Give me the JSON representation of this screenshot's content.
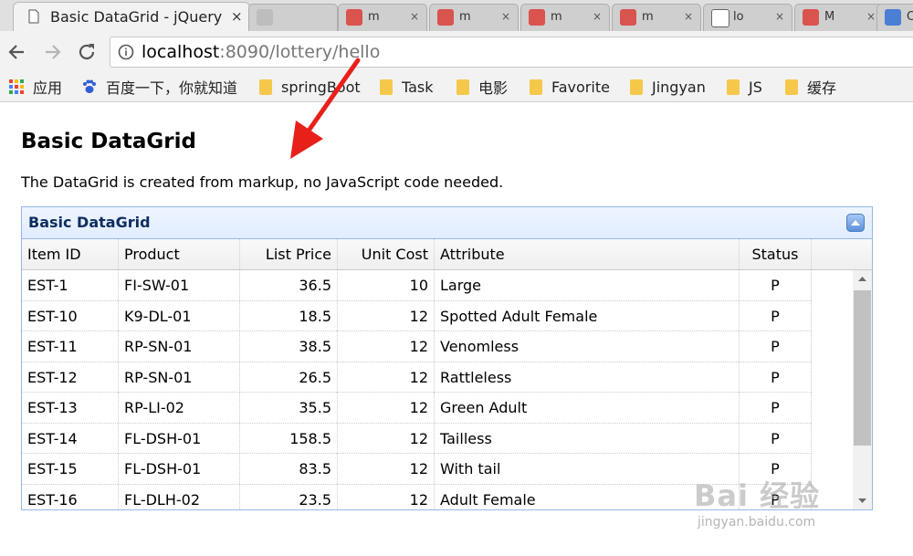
{
  "browser": {
    "active_tab": {
      "title": "Basic DataGrid - jQuery",
      "close": "×"
    },
    "background_tabs": [
      {
        "label": "",
        "close": "",
        "color": "#bdbdbd"
      },
      {
        "label": "m",
        "close": "×",
        "color": "#d9534f"
      },
      {
        "label": "m",
        "close": "×",
        "color": "#d9534f"
      },
      {
        "label": "m",
        "close": "×",
        "color": "#d9534f"
      },
      {
        "label": "m",
        "close": "×",
        "color": "#d9534f"
      },
      {
        "label": "lo",
        "close": "×",
        "color": "#ffffff"
      },
      {
        "label": "M",
        "close": "×",
        "color": "#d9534f"
      },
      {
        "label": "Co",
        "close": "",
        "color": "#4a7fd4"
      }
    ],
    "url_host": "localhost",
    "url_rest": ":8090/lottery/hello",
    "bookmarks": [
      {
        "label": "应用",
        "icon": "apps-grid-icon"
      },
      {
        "label": "百度一下，你就知道",
        "icon": "baidu-paw-icon"
      },
      {
        "label": "springBoot",
        "icon": "folder-icon"
      },
      {
        "label": "Task",
        "icon": "folder-icon"
      },
      {
        "label": "电影",
        "icon": "folder-icon"
      },
      {
        "label": "Favorite",
        "icon": "folder-icon"
      },
      {
        "label": "Jingyan",
        "icon": "folder-icon"
      },
      {
        "label": "JS",
        "icon": "folder-icon"
      },
      {
        "label": "缓存",
        "icon": "folder-icon"
      }
    ]
  },
  "page": {
    "title": "Basic DataGrid",
    "description": "The DataGrid is created from markup, no JavaScript code needed."
  },
  "datagrid": {
    "panel_title": "Basic DataGrid",
    "columns": [
      "Item ID",
      "Product",
      "List Price",
      "Unit Cost",
      "Attribute",
      "Status"
    ],
    "rows": [
      [
        "EST-1",
        "FI-SW-01",
        "36.5",
        "10",
        "Large",
        "P"
      ],
      [
        "EST-10",
        "K9-DL-01",
        "18.5",
        "12",
        "Spotted Adult Female",
        "P"
      ],
      [
        "EST-11",
        "RP-SN-01",
        "38.5",
        "12",
        "Venomless",
        "P"
      ],
      [
        "EST-12",
        "RP-SN-01",
        "26.5",
        "12",
        "Rattleless",
        "P"
      ],
      [
        "EST-13",
        "RP-LI-02",
        "35.5",
        "12",
        "Green Adult",
        "P"
      ],
      [
        "EST-14",
        "FL-DSH-01",
        "158.5",
        "12",
        "Tailless",
        "P"
      ],
      [
        "EST-15",
        "FL-DSH-01",
        "83.5",
        "12",
        "With tail",
        "P"
      ],
      [
        "EST-16",
        "FL-DLH-02",
        "23.5",
        "12",
        "Adult Female",
        "P"
      ]
    ]
  },
  "watermark": {
    "logo": "Bai 经验",
    "url": "jingyan.baidu.com"
  },
  "colors": {
    "panel_border": "#95b8e7",
    "panel_title": "#0e2d5f",
    "arrow": "#e8201a"
  }
}
